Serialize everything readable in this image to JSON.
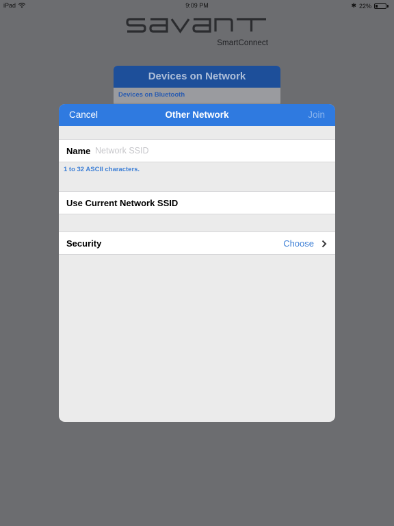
{
  "status_bar": {
    "device": "iPad",
    "time": "9:09 PM",
    "battery_percent": "22%",
    "battery_level": 0.22,
    "icons": [
      "wifi-icon",
      "bluetooth-icon",
      "battery-icon"
    ]
  },
  "logo": {
    "brand": "savant",
    "subtitle": "SmartConnect"
  },
  "background_card": {
    "title": "Devices on Network",
    "section": "Devices on Bluetooth"
  },
  "modal": {
    "cancel_label": "Cancel",
    "title": "Other Network",
    "join_label": "Join",
    "name_label": "Name",
    "name_value": "",
    "name_placeholder": "Network SSID",
    "hint": "1 to 32 ASCII characters.",
    "use_current_label": "Use Current Network SSID",
    "security_label": "Security",
    "security_value": "Choose"
  },
  "colors": {
    "nav_blue": "#2f7ae0",
    "link_blue": "#3d7fd6",
    "backdrop": "#6c6d70",
    "join_disabled": "#8bb5ee"
  }
}
